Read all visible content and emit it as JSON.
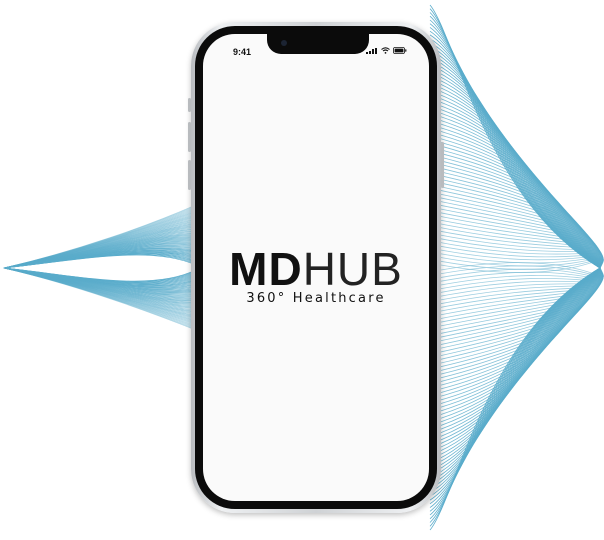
{
  "status_bar": {
    "time": "9:41",
    "icons": [
      "cellular-signal-icon",
      "wifi-icon",
      "battery-icon"
    ]
  },
  "logo": {
    "primary_bold": "MD",
    "primary_light": "HUB",
    "tagline": "360° Healthcare"
  },
  "colors": {
    "wave": "#5aaccb",
    "phone_frame": "#0b0b0b",
    "screen": "#fafafa",
    "text": "#111111"
  }
}
